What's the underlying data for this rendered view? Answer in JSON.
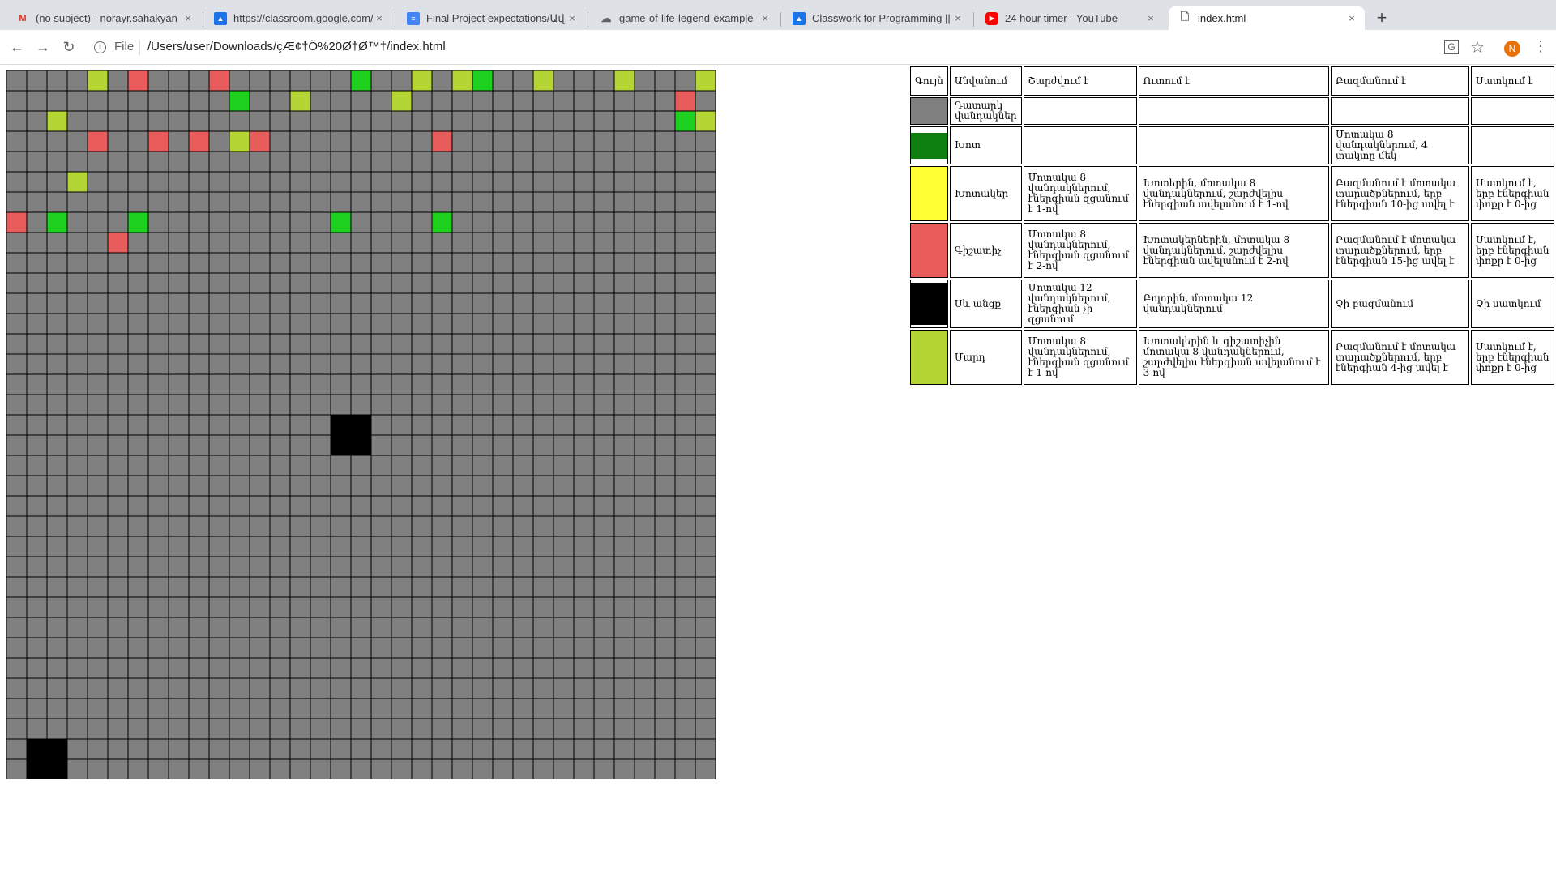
{
  "browser": {
    "tabs": [
      {
        "title": "(no subject) - norayr.sahakyan",
        "icon": "gmail-icon",
        "active": false
      },
      {
        "title": "https://classroom.google.com/",
        "icon": "classroom-icon",
        "active": false
      },
      {
        "title": "Final Project expectations/Ավ...",
        "icon": "docs-icon",
        "active": false
      },
      {
        "title": "game-of-life-legend-example",
        "icon": "cloud-icon",
        "active": false
      },
      {
        "title": "Classwork for Programming || A",
        "icon": "classroom-icon",
        "active": false
      },
      {
        "title": "24 hour timer - YouTube",
        "icon": "youtube-icon",
        "active": false
      },
      {
        "title": "index.html",
        "icon": "file-icon",
        "active": true
      }
    ],
    "close_glyph": "×",
    "new_tab_glyph": "+",
    "file_label": "File",
    "url": "/Users/user/Downloads/çÆ¢†Ö%20Ø†Ø™†/index.html",
    "avatar_letter": "N"
  },
  "grid": {
    "cols": 35,
    "rows": 35,
    "palette": [
      "#808080",
      "#1fd11f",
      "#b5d534",
      "#e85c5c",
      "#000000",
      "#474629"
    ],
    "cells": [
      "00002030003000000100202100200020002",
      "00000000000100200002000000000000030",
      "00200000000000000000000000000000012",
      "00003003030230000000030000000000000",
      "00000000000000000000000000000000000",
      "00020000000000000000000000000000000",
      "00000000000000000000000000000000000",
      "30100010000000001000010000000000000",
      "00000300000000000000000000000000000",
      "00000000000000000000000000000000000",
      "00000000000000000000000000000000000",
      "00000000000000000000000000000000000",
      "00000000000000000000000000000000000",
      "00000000000000000000000000000000000",
      "00000000000000000000000000000000000",
      "00000000000000000000000000000000000",
      "00000000000000000000000000000000000",
      "00000000000000000000000000000000000",
      "00000000000000000000000000000000000",
      "00000000000000000000000000000000000",
      "00000000000000000000000000000000000",
      "00000000000000000000000000000000000",
      "00000000000000000000000000000000000",
      "00000000000000000000000000000000000",
      "00000000000000000000000000000000000",
      "00000000000000000000000000000000000",
      "00000000000000000000000000000000000",
      "00000000000000000000000000000000000",
      "00000000000000000000000000000000000",
      "00000000000000000000000000000000000",
      "00000000000000000000000000000000000",
      "00000000000000000000000000000000000",
      "00000000000000000000000000000000000",
      "00000000000000000000000000000000000",
      "00000000000000000000000000000000000"
    ],
    "big_blocks": [
      {
        "col": 16,
        "row": 17,
        "size": 2
      },
      {
        "col": 1,
        "row": 33,
        "size": 2
      }
    ]
  },
  "legend": {
    "headers": [
      "Գույն",
      "Անվանում",
      "Շարժվում է",
      "Ուտում է",
      "Բազմանում է",
      "Սատկում է"
    ],
    "rows": [
      {
        "color": "#808080",
        "name": "Դատարկ վանդակներ",
        "moves": "",
        "eats": "",
        "multiplies": "",
        "dies": ""
      },
      {
        "color": "#0e8012",
        "name": "Խոտ",
        "moves": "",
        "eats": "",
        "multiplies": "Մոտակա 8 վանդակներում, 4 տակտը մեկ",
        "dies": ""
      },
      {
        "color": "#ffff33",
        "name": "Խոտակեր",
        "moves": "Մոտակա 8 վանդակներում, էներգիան զցանում է 1-ով",
        "eats": "Խոտերին, մոտակա 8 վանդակներում, շարժվելիս էներգիան ավելանում է 1-ով",
        "multiplies": "Բազմանում է մոտակա տարածքներում, երբ էներգիան 10-ից ավել է",
        "dies": "Սատկում է, երբ էներգիան փոքր է 0-ից"
      },
      {
        "color": "#e85c5c",
        "name": "Գիշատիչ",
        "moves": "Մոտակա 8 վանդակներում, էներգիան զցանում է 2-ով",
        "eats": "Խոտակերներին, մոտակա 8 վանդակներում, շարժվելիս էներգիան ավելանում է 2-ով",
        "multiplies": "Բազմանում է մոտակա տարածքներում, երբ էներգիան 15-ից ավել է",
        "dies": "Սատկում է, երբ էներգիան փոքր է 0-ից"
      },
      {
        "color": "#000000",
        "name": "Սև անցք",
        "moves": "Մոտակա 12 վանդակներում, էներգիան չի զցանում",
        "eats": "Բոլորին, մոտակա 12 վանդակներում",
        "multiplies": "Չի բազմանում",
        "dies": "Չի սատկում"
      },
      {
        "color": "#b5d534",
        "name": "Մարդ",
        "moves": "Մոտակա 8 վանդակներում, էներգիան զցանում է 1-ով",
        "eats": "Խոտակերին և գիշատիչին մոտակա 8 վանդակներում, շարժվելիս էներգիան ավելանում է 3-ով",
        "multiplies": "Բազմանում է մոտակա տարածքներում, երբ էներգիան 4-ից ավել է",
        "dies": "Սատկում է, երբ էներգիան փոքր է 0-ից"
      }
    ]
  }
}
